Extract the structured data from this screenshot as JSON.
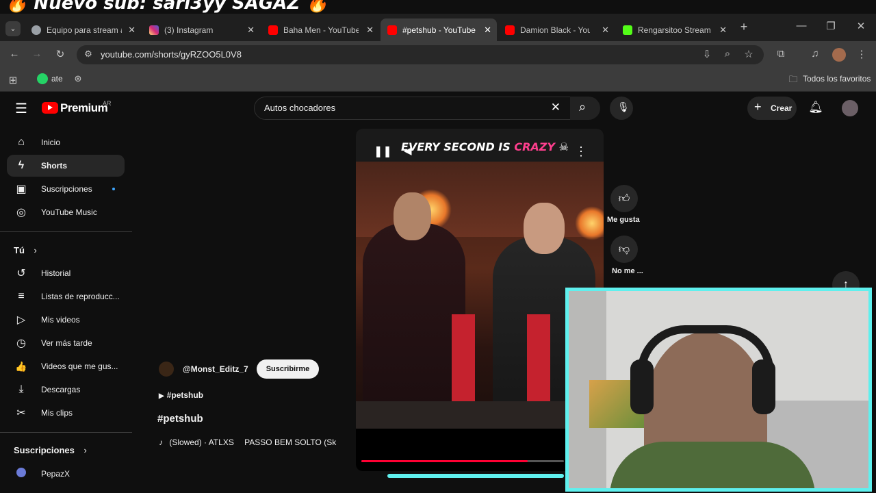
{
  "overlay": {
    "banner_text": "🔥 Nuevo sub: sarl3yy SAGAZ 🔥"
  },
  "browser": {
    "tabs": [
      {
        "label": "Equipo para stream a",
        "color": "#9aa0a6"
      },
      {
        "label": "(3) Instagram",
        "color": "#d6249f"
      },
      {
        "label": "Baha Men - YouTube",
        "color": "#ff0000"
      },
      {
        "label": "#petshub - YouTube",
        "color": "#ff0000",
        "active": true
      },
      {
        "label": "Damion Black - YouT",
        "color": "#ff0000"
      },
      {
        "label": "Rengarsitoo Stream",
        "color": "#53fc18"
      }
    ],
    "new_tab": "+",
    "url": "youtube.com/shorts/gyRZOO5L0V8",
    "bookmarks": {
      "whatsapp_label": "ate",
      "all_favorites": "Todos los favoritos"
    }
  },
  "youtube": {
    "logo_text": "Premium",
    "region": "AR",
    "search_value": "Autos chocadores",
    "create_label": "Crear",
    "sidebar": {
      "main": [
        {
          "label": "Inicio",
          "icon": "⌂"
        },
        {
          "label": "Shorts",
          "icon": "ϟ",
          "active": true
        },
        {
          "label": "Suscripciones",
          "icon": "▣"
        },
        {
          "label": "YouTube Music",
          "icon": "◎"
        }
      ],
      "you_heading": "Tú",
      "you": [
        {
          "label": "Historial",
          "icon": "↺"
        },
        {
          "label": "Listas de reproducc...",
          "icon": "≡"
        },
        {
          "label": "Mis videos",
          "icon": "▷"
        },
        {
          "label": "Ver más tarde",
          "icon": "◷"
        },
        {
          "label": "Videos que me gus...",
          "icon": "👍"
        },
        {
          "label": "Descargas",
          "icon": "⤓"
        },
        {
          "label": "Mis clips",
          "icon": "✂"
        }
      ],
      "subs_heading": "Suscripciones",
      "subs": [
        {
          "label": "PepazX"
        }
      ]
    },
    "short": {
      "overlay_text_a": "EVERY SECOND IS ",
      "overlay_text_b": "CRAZY",
      "channel": "@Monst_Editz_7",
      "subscribe_label": "Suscribirme",
      "hashtag_link": "#petshub",
      "title": "#petshub",
      "music": "(Slowed) · ATLXS",
      "music_2": "PASSO BEM SOLTO (Sk",
      "like_label": "Me gusta",
      "dislike_label": "No me ...",
      "progress": 0.82
    }
  }
}
